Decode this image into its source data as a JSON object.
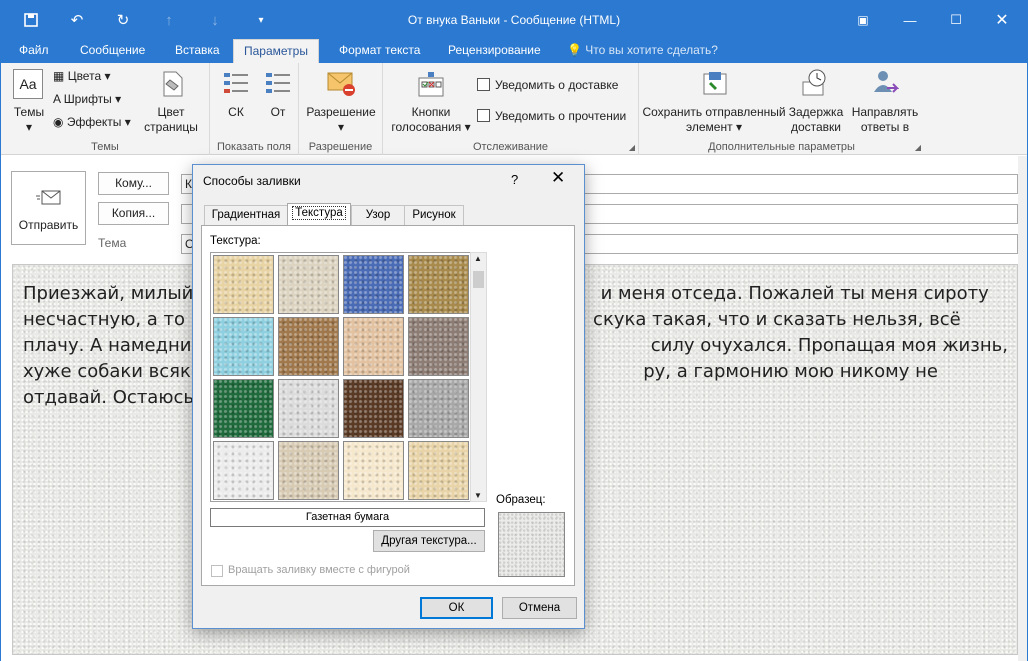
{
  "window": {
    "title": "От внука Ваньки - Сообщение (HTML)"
  },
  "ribbon_tabs": [
    "Файл",
    "Сообщение",
    "Вставка",
    "Параметры",
    "Формат текста",
    "Рецензирование"
  ],
  "tell_me": "Что вы хотите сделать?",
  "ribbon": {
    "themes": {
      "themes_label": "Темы",
      "colors": "Цвета",
      "fonts": "Шрифты",
      "effects": "Эффекты",
      "page_color": "Цвет страницы",
      "group": "Темы"
    },
    "fields": {
      "bcc": "СК",
      "from": "От",
      "group": "Показать поля"
    },
    "permission": {
      "label": "Разрешение",
      "group": "Разрешение"
    },
    "tracking": {
      "voting": "Кнопки голосования",
      "delivery": "Уведомить о доставке",
      "read": "Уведомить о прочтении",
      "group": "Отслеживание"
    },
    "more": {
      "save_sent": "Сохранить отправленный элемент",
      "delay": "Задержка доставки",
      "direct": "Направлять ответы в",
      "group": "Дополнительные параметры"
    }
  },
  "compose": {
    "send": "Отправить",
    "to_btn": "Кому...",
    "cc_btn": "Копия...",
    "subject_label": "Тема",
    "to_value": "Ко",
    "subject_value": "О",
    "body": "Приезжай, милый д                                                                    и меня отседа. Пожалей ты меня сироту несчастную, а то ме                                                                  скука такая, что и сказать нельзя, всё плачу. А намедни хозяин ко                                                               силу очухался. Пропащая моя жизнь, хуже собаки всякой... А е                                                                  ру, а гармонию мою никому не отдавай. Остаюсь твой внук"
  },
  "dialog": {
    "title": "Способы заливки",
    "help": "?",
    "tabs": [
      "Градиентная",
      "Текстура",
      "Узор",
      "Рисунок"
    ],
    "active_tab": "Текстура",
    "texture_label": "Текстура:",
    "selected_texture": "Газетная бумага",
    "other_texture": "Другая текстура...",
    "sample_label": "Образец:",
    "rotate": "Вращать заливку вместе с фигурой",
    "ok": "ОК",
    "cancel": "Отмена",
    "swatch_colors": [
      "#e8d3a4",
      "#dcd3c0",
      "#4a6bb5",
      "#a88a4c",
      "#8fd0e0",
      "#a0784c",
      "#e2c2a0",
      "#8c7c74",
      "#1f6b3c",
      "#dcdcdc",
      "#5a3a24",
      "#a8a8a8",
      "#ececec",
      "#d8cbb4",
      "#f6e8cc",
      "#e8d4a8"
    ]
  }
}
